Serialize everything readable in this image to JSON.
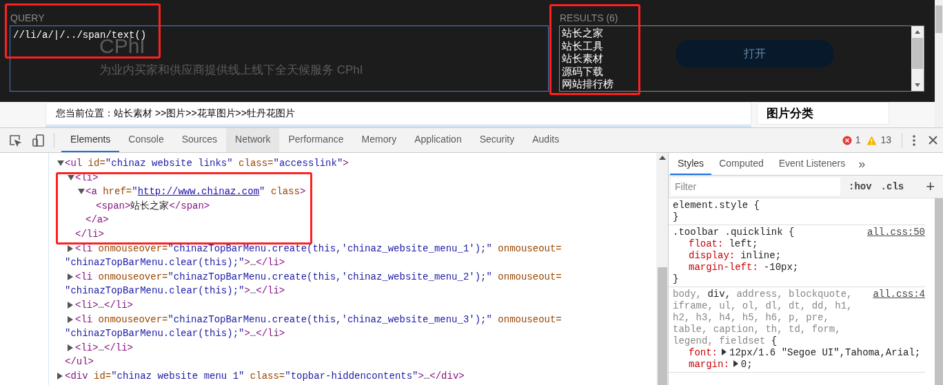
{
  "page": {
    "hero_title": "CPhI",
    "hero_subtitle": "为业内买家和供应商提供线上线下全天候服务 CPhI",
    "open_button": "打开",
    "breadcrumb": "您当前位置：站长素材 >>图片>>花草图片>>牡丹花图片",
    "side_heading": "图片分类"
  },
  "xpath_helper": {
    "query": {
      "label": "QUERY",
      "value": "//li/a/|/../span/text()",
      "highlighted": true
    },
    "results": {
      "label": "RESULTS (6)",
      "highlighted": true,
      "items": [
        "站长之家",
        "站长工具",
        "站长素材",
        "源码下载",
        "网站排行榜"
      ]
    }
  },
  "devtools": {
    "tabs": [
      {
        "label": "Elements",
        "selected": true,
        "hovered": false
      },
      {
        "label": "Console",
        "selected": false,
        "hovered": false
      },
      {
        "label": "Sources",
        "selected": false,
        "hovered": false
      },
      {
        "label": "Network",
        "selected": false,
        "hovered": true
      },
      {
        "label": "Performance",
        "selected": false,
        "hovered": false
      },
      {
        "label": "Memory",
        "selected": false,
        "hovered": false
      },
      {
        "label": "Application",
        "selected": false,
        "hovered": false
      },
      {
        "label": "Security",
        "selected": false,
        "hovered": false
      },
      {
        "label": "Audits",
        "selected": false,
        "hovered": false
      }
    ],
    "errors": "1",
    "warnings": "13",
    "dom_tree": [
      {
        "expanded": true,
        "highlighted": false,
        "lines": [
          [
            {
              "kind": "tag",
              "text": "<ul"
            },
            {
              "kind": "attr",
              "text": " id="
            },
            {
              "kind": "value",
              "text": "\"chinaz website links\""
            },
            {
              "kind": "attr",
              "text": " class="
            },
            {
              "kind": "value",
              "text": "\"accesslink\""
            },
            {
              "kind": "tag",
              "text": ">"
            }
          ]
        ],
        "children": [
          {
            "expanded": true,
            "highlighted": true,
            "lines": [
              [
                {
                  "kind": "tag",
                  "text": "<li>"
                }
              ]
            ],
            "children": [
              {
                "expanded": true,
                "highlighted": false,
                "lines": [
                  [
                    {
                      "kind": "tag",
                      "text": "<a"
                    },
                    {
                      "kind": "attr",
                      "text": " href="
                    },
                    {
                      "kind": "value",
                      "text": "\""
                    },
                    {
                      "kind": "link",
                      "text": "http://www.chinaz.com"
                    },
                    {
                      "kind": "value",
                      "text": "\""
                    },
                    {
                      "kind": "attr",
                      "text": " class"
                    },
                    {
                      "kind": "tag",
                      "text": ">"
                    }
                  ]
                ],
                "children": [
                  {
                    "highlighted": false,
                    "lines": [
                      [
                        {
                          "kind": "tag",
                          "text": "<span>"
                        },
                        {
                          "kind": "text",
                          "text": "站长之家"
                        },
                        {
                          "kind": "tag",
                          "text": "</span>"
                        }
                      ]
                    ]
                  }
                ],
                "closing": [
                  {
                    "kind": "tag",
                    "text": "</a>"
                  }
                ]
              }
            ],
            "closing": [
              {
                "kind": "tag",
                "text": "</li>"
              }
            ]
          },
          {
            "expanded": false,
            "highlighted": false,
            "lines": [
              [
                {
                  "kind": "tag",
                  "text": "<li"
                },
                {
                  "kind": "attr",
                  "text": " onmouseover="
                },
                {
                  "kind": "value",
                  "text": "\"chinazTopBarMenu.create(this,'chinaz_website_menu_1');\""
                },
                {
                  "kind": "attr",
                  "text": " onmouseout="
                }
              ],
              [
                {
                  "kind": "value",
                  "text": "\"chinazTopBarMenu.clear(this);\""
                },
                {
                  "kind": "tag",
                  "text": ">"
                },
                {
                  "kind": "text",
                  "text": "…"
                },
                {
                  "kind": "tag",
                  "text": "</li>"
                }
              ]
            ]
          },
          {
            "expanded": false,
            "highlighted": false,
            "lines": [
              [
                {
                  "kind": "tag",
                  "text": "<li"
                },
                {
                  "kind": "attr",
                  "text": " onmouseover="
                },
                {
                  "kind": "value",
                  "text": "\"chinazTopBarMenu.create(this,'chinaz_website_menu_2');\""
                },
                {
                  "kind": "attr",
                  "text": " onmouseout="
                }
              ],
              [
                {
                  "kind": "value",
                  "text": "\"chinazTopBarMenu.clear(this);\""
                },
                {
                  "kind": "tag",
                  "text": ">"
                },
                {
                  "kind": "text",
                  "text": "…"
                },
                {
                  "kind": "tag",
                  "text": "</li>"
                }
              ]
            ]
          },
          {
            "expanded": false,
            "highlighted": false,
            "lines": [
              [
                {
                  "kind": "tag",
                  "text": "<li>"
                },
                {
                  "kind": "text",
                  "text": "…"
                },
                {
                  "kind": "tag",
                  "text": "</li>"
                }
              ]
            ]
          },
          {
            "expanded": false,
            "highlighted": false,
            "lines": [
              [
                {
                  "kind": "tag",
                  "text": "<li"
                },
                {
                  "kind": "attr",
                  "text": " onmouseover="
                },
                {
                  "kind": "value",
                  "text": "\"chinazTopBarMenu.create(this,'chinaz_website_menu_3');\""
                },
                {
                  "kind": "attr",
                  "text": " onmouseout="
                }
              ],
              [
                {
                  "kind": "value",
                  "text": "\"chinazTopBarMenu.clear(this);\""
                },
                {
                  "kind": "tag",
                  "text": ">"
                },
                {
                  "kind": "text",
                  "text": "…"
                },
                {
                  "kind": "tag",
                  "text": "</li>"
                }
              ]
            ]
          },
          {
            "expanded": false,
            "highlighted": false,
            "lines": [
              [
                {
                  "kind": "tag",
                  "text": "<li>"
                },
                {
                  "kind": "text",
                  "text": "…"
                },
                {
                  "kind": "tag",
                  "text": "</li>"
                }
              ]
            ]
          }
        ],
        "closing": [
          {
            "kind": "tag",
            "text": "</ul>"
          }
        ]
      },
      {
        "expanded": false,
        "highlighted": false,
        "lines": [
          [
            {
              "kind": "tag",
              "text": "<div"
            },
            {
              "kind": "attr",
              "text": " id="
            },
            {
              "kind": "value",
              "text": "\"chinaz website menu 1\""
            },
            {
              "kind": "attr",
              "text": " class="
            },
            {
              "kind": "value",
              "text": "\"topbar-hiddencontents\""
            },
            {
              "kind": "tag",
              "text": ">"
            },
            {
              "kind": "text",
              "text": "…"
            },
            {
              "kind": "tag",
              "text": "</div>"
            }
          ]
        ]
      }
    ],
    "side_tabs": [
      {
        "label": "Styles",
        "selected": true
      },
      {
        "label": "Computed",
        "selected": false
      },
      {
        "label": "Event Listeners",
        "selected": false
      }
    ],
    "side_more": "»",
    "filter": {
      "placeholder": "Filter"
    },
    "hov": ":hov",
    "cls": ".cls",
    "add": "+",
    "rules": [
      {
        "selectors": [
          {
            "text": "element.style",
            "matched": true
          }
        ],
        "open": " {",
        "close": "}"
      },
      {
        "selectors": [
          {
            "text": ".toolbar .quicklink",
            "matched": true
          }
        ],
        "open": " {",
        "close": "}",
        "source": "all.css:50",
        "declarations": [
          {
            "property": "float:",
            "value": "left;",
            "expandable": false
          },
          {
            "property": "display:",
            "value": "inline;",
            "expandable": false
          },
          {
            "property": "margin-left:",
            "value": "-10px;",
            "expandable": false
          }
        ]
      },
      {
        "selectors": [
          {
            "text": "body, ",
            "matched": false
          },
          {
            "text": "div, ",
            "matched": true
          },
          {
            "text": "address, blockquote, iframe, ul, ol, dl, dt, dd, h1, h2, h3, h4, h5, h6, p, pre, table, caption, th, td, form, legend, fieldset",
            "matched": false
          }
        ],
        "open": " {",
        "source": "all.css:4",
        "declarations": [
          {
            "property": "font:",
            "value": "12px/1.6 \"Segoe UI\",Tahoma,Arial;",
            "expandable": true
          },
          {
            "property": "margin:",
            "value": "0;",
            "expandable": true
          }
        ]
      }
    ]
  }
}
